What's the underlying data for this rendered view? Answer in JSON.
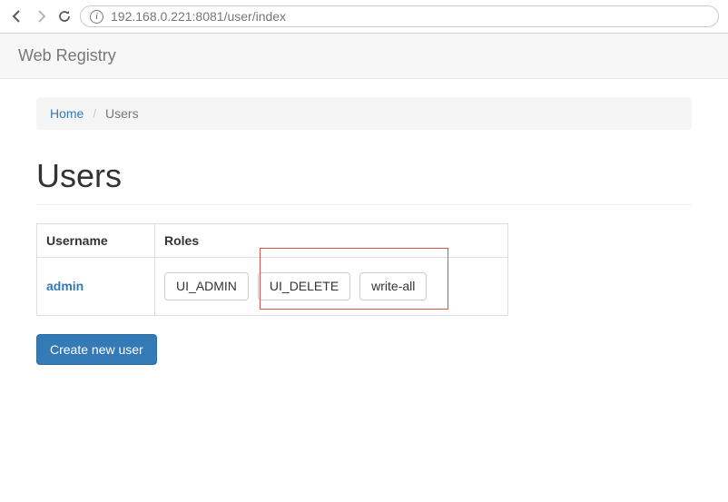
{
  "browser": {
    "url": "192.168.0.221:8081/user/index"
  },
  "header": {
    "brand": "Web Registry"
  },
  "breadcrumb": {
    "home": "Home",
    "current": "Users"
  },
  "page": {
    "title": "Users"
  },
  "table": {
    "headers": {
      "username": "Username",
      "roles": "Roles"
    },
    "rows": [
      {
        "username": "admin",
        "roles": [
          "UI_ADMIN",
          "UI_DELETE",
          "write-all"
        ]
      }
    ]
  },
  "actions": {
    "create": "Create new user"
  },
  "annotation": {
    "note": "red-box-highlighting-ui_delete-and-write-all"
  }
}
